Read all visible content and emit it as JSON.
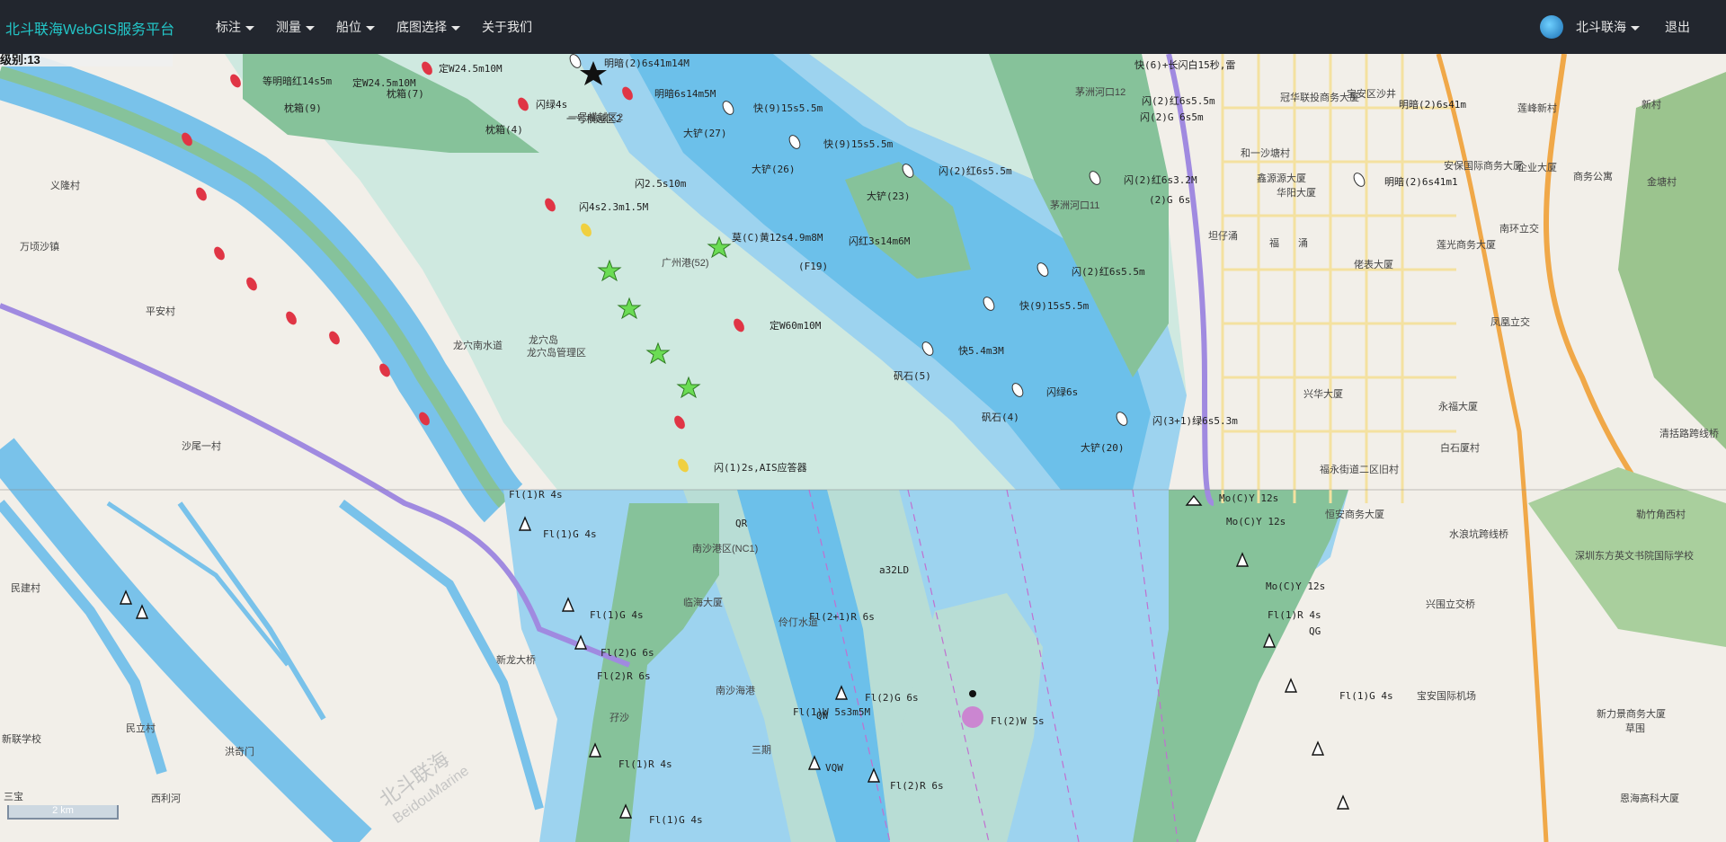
{
  "app": {
    "title": "北斗联海WebGIS服务平台"
  },
  "nav": [
    {
      "label": "标注"
    },
    {
      "label": "测量"
    },
    {
      "label": "船位"
    },
    {
      "label": "底图选择"
    },
    {
      "label": "关于我们"
    }
  ],
  "user": {
    "name": "北斗联海",
    "logout": "退出"
  },
  "map": {
    "level": "级别:13",
    "scale": "2 km",
    "watermark_cn": "北斗联海",
    "watermark_en": "BeidouMarine",
    "places": [
      "万顷沙镇",
      "义隆村",
      "平安村",
      "沙尾一村",
      "民建村",
      "民立村",
      "洪奇门",
      "新联学校",
      "西利河",
      "三宝",
      "龙穴岛",
      "龙穴岛管理区",
      "龙穴南水道",
      "临海大厦",
      "南沙海港",
      "南沙港区(NC1)",
      "新龙大桥",
      "孖沙",
      "三期",
      "伶仃水道",
      "一号横越区2",
      "广州港(52)",
      "福永街道二区旧村",
      "兴华大厦",
      "永福大厦",
      "白石厦村",
      "凤凰立交",
      "南环立交",
      "恒安商务大厦",
      "水浪坑跨线桥",
      "兴围立交桥",
      "宝安国际机场",
      "深圳东方英文书院国际学校",
      "恩海高科大厦",
      "清括路跨线桥",
      "勒竹角西村",
      "新村",
      "金塘村",
      "冠华联投商务大厦",
      "安保国际商务大厦",
      "企业大厦",
      "商务公寓",
      "华阳大厦",
      "莲光商务大厦",
      "佬表大厦",
      "鑫源源大厦",
      "莲峰新村",
      "宝安区沙井",
      "和一沙塘村",
      "茅洲河口12",
      "茅洲河口11",
      "坦仔涌",
      "福",
      "涌",
      "草围",
      "新力景商务大厦"
    ],
    "buoys": [
      "明暗(2)6s41m14M",
      "明暗6s14m5M",
      "等明暗红14s5m",
      "定W24.5m10M",
      "定W24.5m10M",
      "枕箱(9)",
      "枕箱(7)",
      "枕箱(4)",
      "闪绿4s",
      "快(9)15s5.5m",
      "大铲(27)",
      "快(9)15s5.5m",
      "大铲(26)",
      "闪(2)红6s5.5m",
      "大铲(23)",
      "闪2.5s10m",
      "闪4s2.3m1.5M",
      "莫(C)黄12s4.9m8M",
      "闪红3s14m6M",
      "(F19)",
      "定W60m10M",
      "快(9)15s5.5m",
      "闪(2)红6s5.5m",
      "快5.4m3M",
      "矾石(5)",
      "闪绿6s",
      "矾石(4)",
      "闪(3+1)绿6s5.3m",
      "大铲(20)",
      "闪(1)2s,AIS应答器",
      "Fl(1)R 4s",
      "Fl(1)G 4s",
      "Fl(1)G 4s",
      "Fl(2)G 6s",
      "Fl(2)R 6s",
      "Fl(2+1)R 6s",
      "Fl(2)W 5s",
      "Fl(2)G 6s",
      "Fl(1)W 5s3m5M",
      "Fl(1)R 4s",
      "Fl(2)R 6s",
      "Fl(1)G 4s",
      "Mo(C)Y 12s",
      "Mo(C)Y 12s",
      "Mo(C)Y 12s",
      "Fl(1)G 4s",
      "Fl(1)R 4s",
      "QG",
      "QR",
      "QW",
      "VQW",
      "a32LD",
      "快(6)+长闪白15秒,雷",
      "闪(2)G 6s5m",
      "闪(2)红6s5.5m",
      "闪(2)红6s3.2M",
      "(2)G 6s",
      "明暗(2)6s41m",
      "明暗(2)6s41m1",
      "一号横越区2"
    ]
  }
}
